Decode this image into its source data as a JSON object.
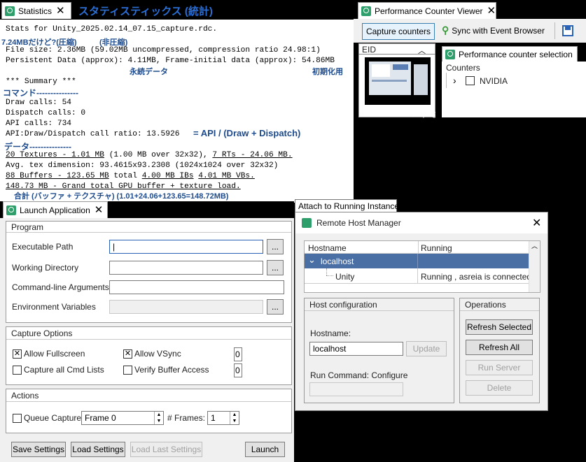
{
  "stats": {
    "tab_label": "Statistics",
    "heading_annotation": "スタティスティックス (統計)",
    "lines": [
      "Stats for Unity_2025.02.14_07.15_capture.rdc.",
      "File size: 2.36MB (59.02MB uncompressed, compression ratio 24.98:1)",
      "Persistent Data (approx): 4.11MB, Frame-initial data (approx): 54.86MB",
      "*** Summary ***",
      "Draw calls: 54",
      "Dispatch calls: 0",
      "API calls: 734",
      "API:Draw/Dispatch call ratio: 13.5926",
      "20 Textures - 1.01 MB",
      " (1.00 MB over 32x32), ",
      "7 RTs - 24.06 MB.",
      "Avg. tex dimension: 93.4615x93.2308 (1024x1024 over 32x32)",
      "88 Buffers - 123.65 MB",
      " total ",
      "4.00 MB IBs",
      " ",
      "4.01 MB VBs.",
      "148.73 MB - Grand total GPU buffer + texture load."
    ],
    "annotations": {
      "compressed": "7.24MBだけど?(圧縮)",
      "uncompressed": "(非圧縮)",
      "persistent": "永続データ",
      "frame_initial": "初期化用",
      "commands": "コマンド---------------",
      "ratio": "= API / (Draw + Dispatch)",
      "data": "データ---------------",
      "total": "合計 (バッファ + テクスチャ) (1.01+24.06+123.65=148.72MB)"
    }
  },
  "perf": {
    "tab_label": "Performance Counter Viewer",
    "capture_button": "Capture counters",
    "sync_label": "Sync with Event Browser",
    "eid_header": "EID",
    "thumb_label": "PIXデバッグ.png",
    "selection_tab": "Performance counter selection",
    "counters_header": "Counters",
    "nvidia": "NVIDIA"
  },
  "launch": {
    "tab_label": "Launch Application",
    "program_group": "Program",
    "exe_label": "Executable Path",
    "workdir_label": "Working Directory",
    "cmdline_label": "Command-line Arguments",
    "env_label": "Environment Variables",
    "exe_value": "|",
    "browse": "...",
    "capture_group": "Capture Options",
    "allow_fullscreen": "Allow Fullscreen",
    "allow_vsync": "Allow VSync",
    "capture_all": "Capture all Cmd Lists",
    "verify_buffer": "Verify Buffer Access",
    "opt_value1": "0",
    "opt_value2": "0",
    "actions_group": "Actions",
    "queue_capture": "Queue Capture",
    "frame_value": "Frame 0",
    "frames_label": "# Frames:",
    "frames_value": "1",
    "save_settings": "Save Settings",
    "load_settings": "Load Settings",
    "load_last": "Load Last Settings",
    "launch": "Launch"
  },
  "remote": {
    "attach_tab": "Attach to Running Instance",
    "title": "Remote Host Manager",
    "col_host": "Hostname",
    "col_running": "Running",
    "host": "localhost",
    "child": "Unity",
    "child_status": "Running , asreia is connected",
    "host_config_group": "Host configuration",
    "hostname_label": "Hostname:",
    "hostname_value": "localhost",
    "update": "Update",
    "run_cmd_label": "Run Command: Configure",
    "operations_group": "Operations",
    "refresh_selected": "Refresh Selected",
    "refresh_all": "Refresh All",
    "run_server": "Run Server",
    "delete": "Delete"
  },
  "colors": {
    "accent": "#1e4b8c",
    "selection": "#4a6fa5",
    "tab_icon": "#2e9e6a"
  }
}
